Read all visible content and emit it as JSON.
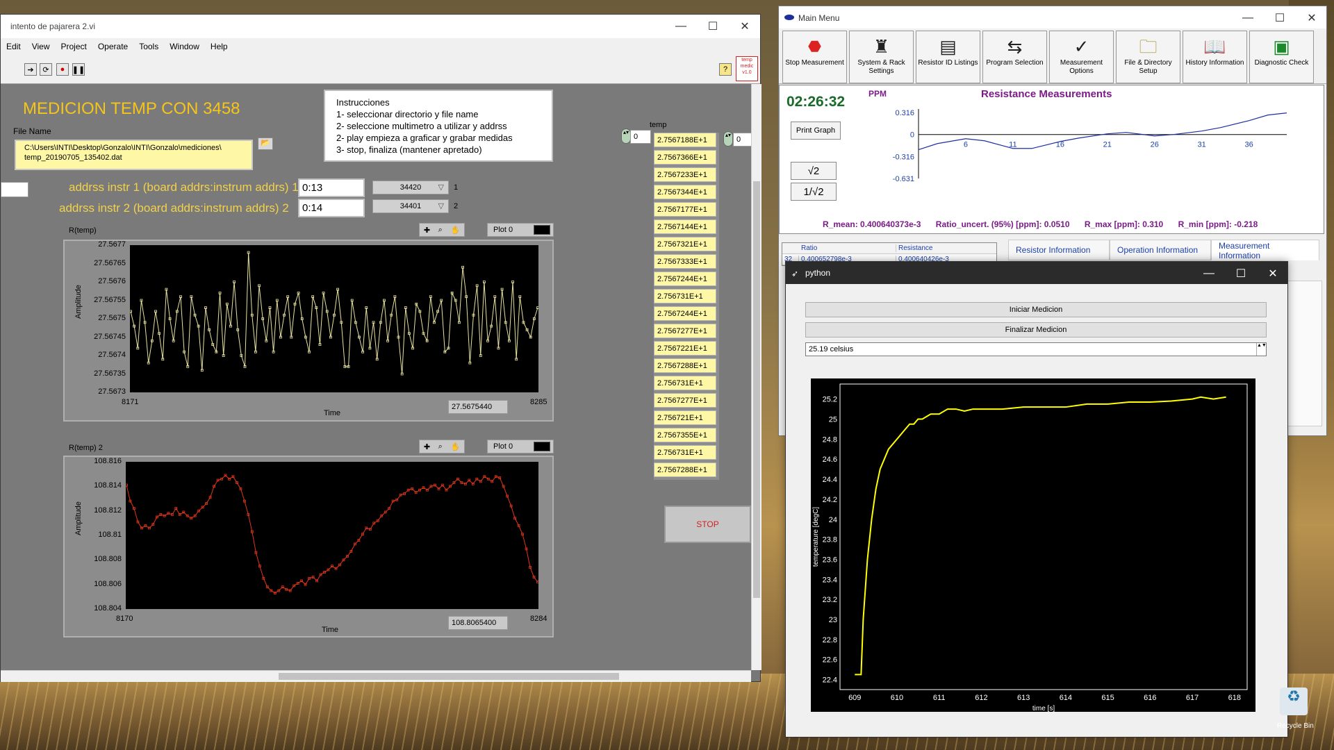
{
  "labview": {
    "title": "intento de pajarera 2.vi",
    "menu": [
      "Edit",
      "View",
      "Project",
      "Operate",
      "Tools",
      "Window",
      "Help"
    ],
    "heading": "MEDICION TEMP CON 3458",
    "instructions": [
      "Instrucciones",
      "1- seleccionar directorio y file name",
      "2- seleccione multimetro a utilizar y addrss",
      "2- play empieza a graficar y grabar medidas",
      "3- stop, finaliza (mantener apretado)"
    ],
    "file_name_label": "File Name",
    "file_path_line1": "C:\\Users\\INTI\\Desktop\\Gonzalo\\INTI\\Gonzalo\\mediciones\\",
    "file_path_line2": "temp_20190705_135402.dat",
    "addr1_label": "addrss instr 1  (board addrs:instrum addrs) 1",
    "addr1_value": "0:13",
    "addr1_model": "34420",
    "addr1_index": "1",
    "addr2_label": "addrss instr 2  (board addrs:instrum addrs) 2",
    "addr2_value": "0:14",
    "addr2_model": "34401",
    "addr2_index": "2",
    "graph1": {
      "label": "R(temp)",
      "legend": "Plot 0",
      "ylabel": "Amplitude",
      "xlabel": "Time",
      "x_min": "8171",
      "x_max": "8285",
      "readout": "27.5675440",
      "yticks": [
        "27.5677",
        "27.56765",
        "27.5676",
        "27.56755",
        "27.5675",
        "27.56745",
        "27.5674",
        "27.56735",
        "27.5673"
      ]
    },
    "graph2": {
      "label": "R(temp) 2",
      "legend": "Plot 0",
      "ylabel": "Amplitude",
      "xlabel": "Time",
      "x_min": "8170",
      "x_max": "8284",
      "readout": "108.8065400",
      "yticks": [
        "108.816",
        "108.814",
        "108.812",
        "108.81",
        "108.808",
        "108.806",
        "108.804"
      ]
    },
    "temp_label": "temp",
    "temp_index_left": "0",
    "temp_index_right": "0",
    "temp_values": [
      "2.7567188E+1",
      "2.7567366E+1",
      "2.7567233E+1",
      "2.7567344E+1",
      "2.7567177E+1",
      "2.7567144E+1",
      "2.7567321E+1",
      "2.7567333E+1",
      "2.7567244E+1",
      "2.756731E+1",
      "2.7567244E+1",
      "2.7567277E+1",
      "2.7567221E+1",
      "2.7567288E+1",
      "2.756731E+1",
      "2.7567277E+1",
      "2.756721E+1",
      "2.7567355E+1",
      "2.756731E+1",
      "2.7567288E+1"
    ],
    "stop_label": "STOP",
    "badge": "temp\nmedic\nv1.0"
  },
  "main_menu": {
    "title": "Main Menu",
    "toolbar": [
      {
        "label": "Stop Measurement",
        "icon": "stop-sign-icon"
      },
      {
        "label": "System & Rack Settings",
        "icon": "rack-icon"
      },
      {
        "label": "Resistor ID Listings",
        "icon": "resistor-list-icon"
      },
      {
        "label": "Program Selection",
        "icon": "program-arrows-icon"
      },
      {
        "label": "Measurement Options",
        "icon": "checkmark-icon"
      },
      {
        "label": "File & Directory Setup",
        "icon": "folder-icon"
      },
      {
        "label": "History Information",
        "icon": "book-icon"
      },
      {
        "label": "Diagnostic Check",
        "icon": "scope-icon"
      }
    ],
    "clock": "02:26:32",
    "ppm_label": "PPM",
    "chart_title": "Resistance  Measurements",
    "print_graph": "Print Graph",
    "sqrt2": "√2",
    "inv_sqrt2": "1/√2",
    "stats": {
      "r_mean": "R_mean: 0.400640373e-3",
      "ratio_uncert": "Ratio_uncert. (95%) [ppm]: 0.0510",
      "r_max": "R_max [ppm]: 0.310",
      "r_min": "R_min [ppm]: -0.218"
    },
    "table": {
      "headers": [
        "",
        "Ratio",
        "Resistance"
      ],
      "rows": [
        [
          "32",
          "0.400652798e-3",
          "0.400640426e-3"
        ]
      ]
    },
    "tabs": [
      "Resistor Information",
      "Operation Information",
      "Measurement Information"
    ]
  },
  "python": {
    "title": "python",
    "start_btn": "Iniciar Medicion",
    "stop_btn": "Finalizar Medicion",
    "combo_value": "25.19 celsius",
    "xlabel": "time [s]",
    "ylabel": "temperature [degC]"
  },
  "desktop": {
    "recycle_bin": "Recycle Bin"
  },
  "colors": {
    "labview_title": "#f6c51a",
    "plot1_line": "#e8e2a0",
    "plot2_line": "#e0361c",
    "python_line": "#ffff00",
    "mm_chart_line": "#1d2fa0",
    "mm_title": "#7a1b88"
  },
  "chart_data": [
    {
      "type": "line",
      "ylabel": "Amplitude",
      "xlabel": "Time",
      "x_range": [
        8171,
        8285
      ],
      "ylim": [
        27.5673,
        27.5677
      ],
      "series": [
        {
          "name": "Plot 0",
          "values": [
            27.56752,
            27.56748,
            27.56742,
            27.56755,
            27.56749,
            27.56738,
            27.56744,
            27.56752,
            27.56746,
            27.56739,
            27.56758,
            27.5675,
            27.56744,
            27.56752,
            27.56756,
            27.56741,
            27.56737,
            27.56756,
            27.56751,
            27.56748,
            27.56736,
            27.56753,
            27.56747,
            27.56743,
            27.56741,
            27.56757,
            27.5674,
            27.56754,
            27.56748,
            27.5676,
            27.56747,
            27.5674,
            27.56737,
            27.56768,
            27.56751,
            27.56741,
            27.56759,
            27.5675,
            27.56744,
            27.56753,
            27.56741,
            27.56755,
            27.56745,
            27.56751,
            27.56756,
            27.56745,
            27.56754,
            27.56757,
            27.5675,
            27.56745,
            27.56741,
            27.56756,
            27.56753,
            27.56743,
            27.56757,
            27.56752,
            27.56745,
            27.56751,
            27.56758,
            27.56749,
            27.56737,
            27.56737,
            27.56755,
            27.56749,
            27.56745,
            27.56741,
            27.56753,
            27.56742,
            27.56749,
            27.56739,
            27.56749,
            27.56755,
            27.56744,
            27.56751,
            27.56756,
            27.56745,
            27.56735,
            27.56753,
            27.56746,
            27.56742,
            27.56754,
            27.56752,
            27.56746,
            27.56744,
            27.56756,
            27.56749,
            27.56752,
            27.56755,
            27.56741,
            27.56742,
            27.56757,
            27.56755,
            27.56749,
            27.56764,
            27.56756,
            27.56738,
            27.56751,
            27.56759,
            27.5674,
            27.5676,
            27.56744,
            27.56748,
            27.56756,
            27.56742,
            27.56758,
            27.56749,
            27.56744,
            27.5676,
            27.56739,
            27.56756,
            27.56749,
            27.56747,
            27.56745,
            27.5675,
            27.56753
          ]
        }
      ]
    },
    {
      "type": "line",
      "ylabel": "Amplitude",
      "xlabel": "Time",
      "x_range": [
        8170,
        8284
      ],
      "ylim": [
        108.804,
        108.816
      ],
      "series": [
        {
          "name": "Plot 0",
          "values": [
            108.8141,
            108.8128,
            108.8122,
            108.8111,
            108.8106,
            108.8108,
            108.8106,
            108.8109,
            108.8115,
            108.8117,
            108.8116,
            108.8118,
            108.8117,
            108.8122,
            108.8117,
            108.8119,
            108.8116,
            108.8114,
            108.8116,
            108.812,
            108.8123,
            108.8126,
            108.8131,
            108.814,
            108.8145,
            108.8146,
            108.8149,
            108.8146,
            108.8148,
            108.8143,
            108.8138,
            108.8128,
            108.8117,
            108.8103,
            108.8086,
            108.8075,
            108.8065,
            108.8058,
            108.8055,
            108.8053,
            108.8055,
            108.8058,
            108.8056,
            108.8055,
            108.8059,
            108.8061,
            108.8063,
            108.806,
            108.8065,
            108.8066,
            108.8063,
            108.8068,
            108.807,
            108.8072,
            108.8075,
            108.8073,
            108.8076,
            108.808,
            108.8083,
            108.8087,
            108.8093,
            108.8096,
            108.8101,
            108.8106,
            108.8105,
            108.811,
            108.8112,
            108.8116,
            108.8119,
            108.8122,
            108.8128,
            108.8129,
            108.8133,
            108.8134,
            108.8137,
            108.8138,
            108.8135,
            108.8137,
            108.8139,
            108.8137,
            108.814,
            108.8141,
            108.8138,
            108.8141,
            108.8137,
            108.814,
            108.8143,
            108.8146,
            108.8143,
            108.8142,
            108.8145,
            108.8142,
            108.8146,
            108.8144,
            108.8148,
            108.8146,
            108.8144,
            108.8148,
            108.8147,
            108.814,
            108.8132,
            108.8124,
            108.8114,
            108.8108,
            108.8101,
            108.8089,
            108.8074,
            108.8066,
            108.8062
          ]
        }
      ]
    },
    {
      "type": "line",
      "title": "Resistance  Measurements",
      "ylabel": "PPM",
      "x_ticks": [
        6,
        11,
        16,
        21,
        26,
        31,
        36
      ],
      "y_ticks": [
        0.316,
        0,
        -0.316,
        -0.631
      ],
      "series": [
        {
          "name": "",
          "x": [
            1,
            3,
            6,
            8,
            11,
            13,
            16,
            18,
            21,
            23,
            26,
            28,
            31,
            33,
            36,
            38,
            40
          ],
          "y": [
            -0.218,
            -0.13,
            -0.06,
            -0.09,
            -0.2,
            -0.2,
            -0.1,
            -0.05,
            0.01,
            0.03,
            -0.02,
            0.0,
            0.05,
            0.1,
            0.2,
            0.28,
            0.31
          ]
        }
      ]
    },
    {
      "type": "line",
      "xlabel": "time [s]",
      "ylabel": "temperature [degC]",
      "x_ticks": [
        609,
        610,
        611,
        612,
        613,
        614,
        615,
        616,
        617,
        618
      ],
      "y_ticks": [
        22.4,
        22.6,
        22.8,
        23,
        23.2,
        23.4,
        23.6,
        23.8,
        24,
        24.2,
        24.4,
        24.6,
        24.8,
        25,
        25.2
      ],
      "xlim": [
        608.65,
        618.3
      ],
      "ylim": [
        22.3,
        25.35
      ],
      "series": [
        {
          "name": "",
          "x": [
            609.0,
            609.15,
            609.2,
            609.3,
            609.4,
            609.5,
            609.6,
            609.7,
            609.8,
            609.9,
            610.0,
            610.1,
            610.2,
            610.3,
            610.4,
            610.5,
            610.6,
            610.8,
            611.0,
            611.2,
            611.4,
            611.6,
            611.8,
            612.0,
            612.5,
            613.0,
            613.5,
            614.0,
            614.5,
            615.0,
            615.5,
            616.0,
            616.5,
            617.0,
            617.2,
            617.5,
            617.8
          ],
          "y": [
            22.45,
            22.45,
            23.0,
            23.6,
            24.0,
            24.3,
            24.5,
            24.6,
            24.7,
            24.75,
            24.8,
            24.85,
            24.9,
            24.95,
            24.95,
            25.0,
            25.0,
            25.05,
            25.05,
            25.1,
            25.1,
            25.08,
            25.1,
            25.1,
            25.1,
            25.12,
            25.12,
            25.12,
            25.15,
            25.15,
            25.17,
            25.17,
            25.18,
            25.2,
            25.22,
            25.2,
            25.22
          ]
        }
      ]
    }
  ]
}
